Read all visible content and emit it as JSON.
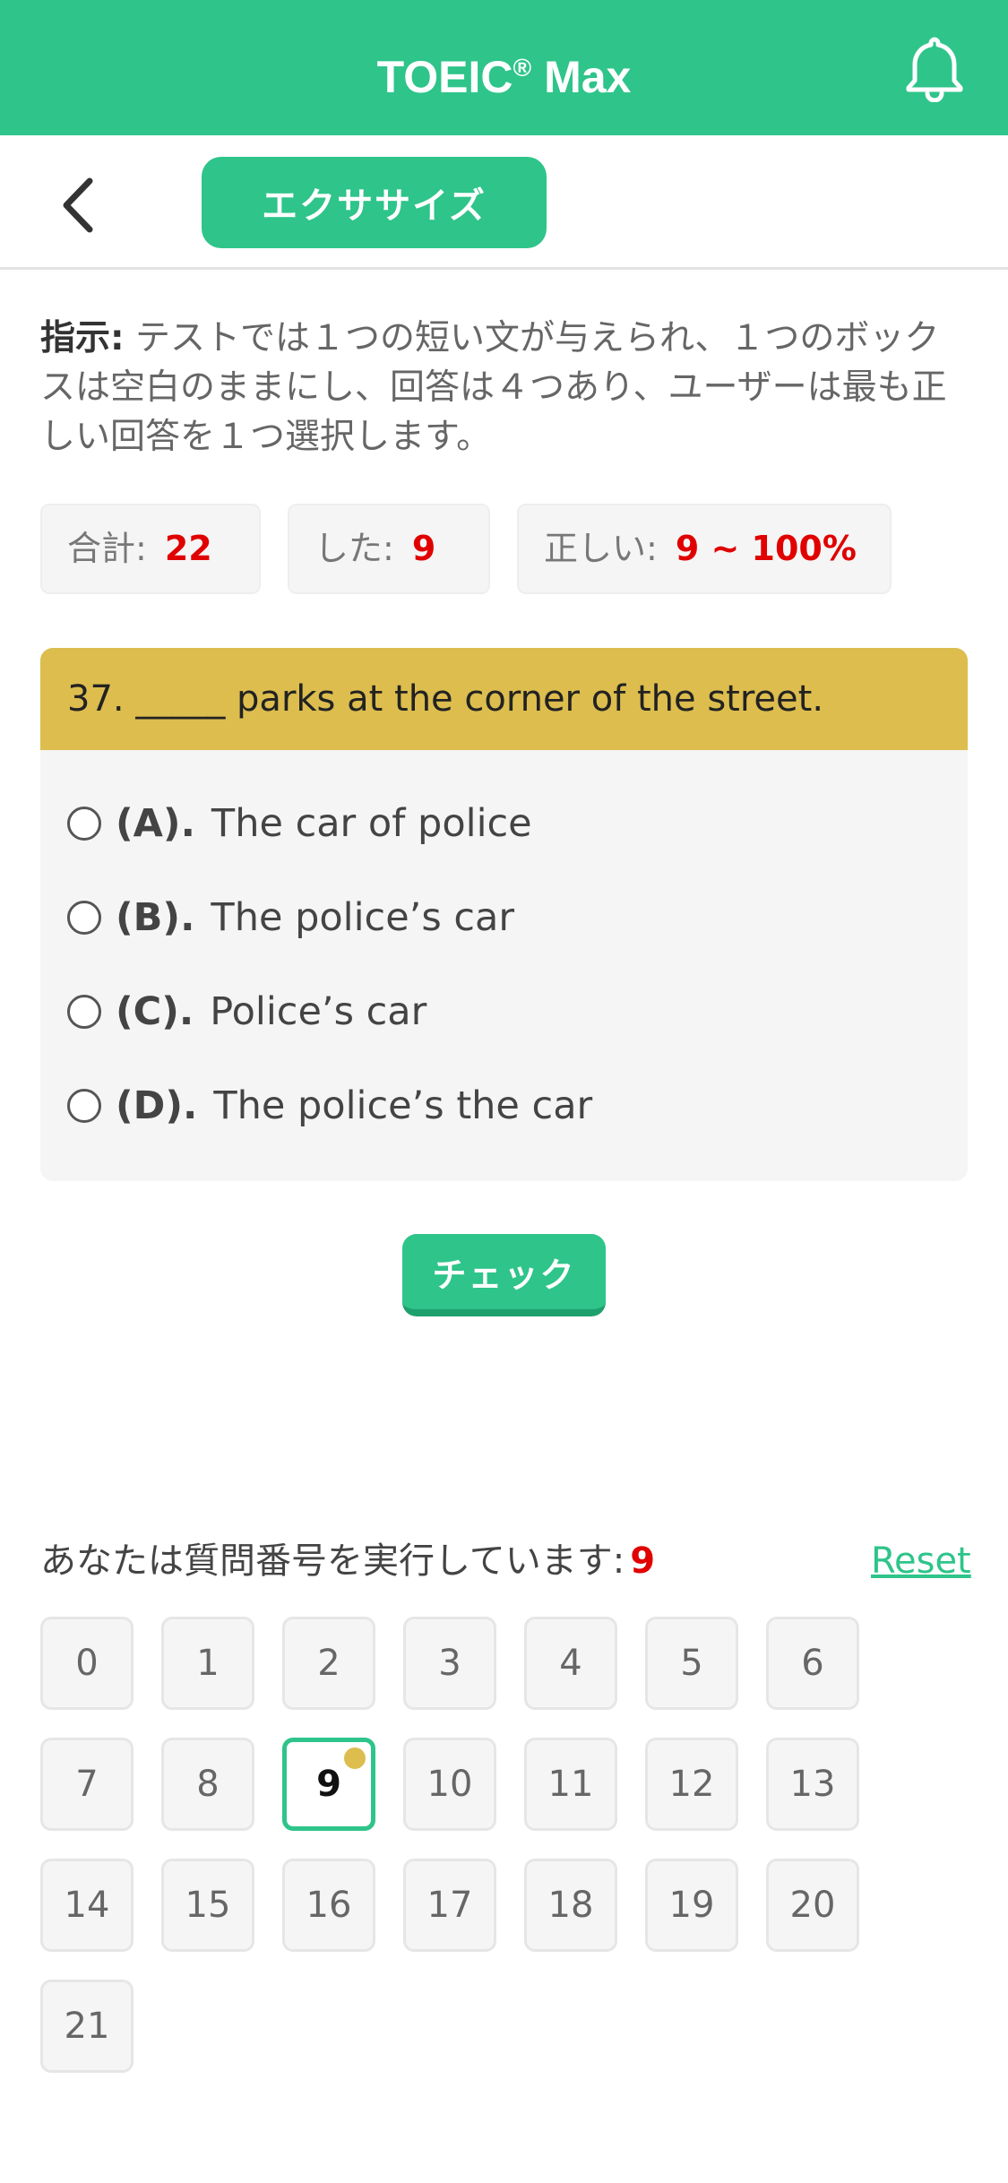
{
  "header": {
    "title": "TOEIC",
    "title_mark": "®",
    "title_suffix": " Max"
  },
  "subheader": {
    "tab_label": "エクササイズ"
  },
  "instruction": {
    "label": "指示:",
    "text": " テストでは１つの短い文が与えられ、１つのボックスは空白のままにし、回答は４つあり、ユーザーは最も正しい回答を１つ選択します。"
  },
  "stats": {
    "total_label": "合計:",
    "total_value": "22",
    "done_label": "した:",
    "done_value": "9",
    "correct_label": "正しい:",
    "correct_value": "9 ~ 100%"
  },
  "question": {
    "text": "37. _____ parks at the corner of the street.",
    "options": [
      {
        "letter": "(A).",
        "text": "The car of police"
      },
      {
        "letter": "(B).",
        "text": "The police’s car"
      },
      {
        "letter": "(C).",
        "text": "Police’s car"
      },
      {
        "letter": "(D).",
        "text": "The police’s the car"
      }
    ]
  },
  "check_label": "チェック",
  "progress": {
    "label": "あなたは質問番号を実行しています:",
    "current": "9",
    "reset_label": "Reset"
  },
  "grid": {
    "numbers": [
      "0",
      "1",
      "2",
      "3",
      "4",
      "5",
      "6",
      "7",
      "8",
      "9",
      "10",
      "11",
      "12",
      "13",
      "14",
      "15",
      "16",
      "17",
      "18",
      "19",
      "20",
      "21"
    ],
    "active": "9"
  },
  "colors": {
    "accent": "#2ec48a",
    "question_header": "#dcbd4e",
    "highlight": "#e00000"
  }
}
